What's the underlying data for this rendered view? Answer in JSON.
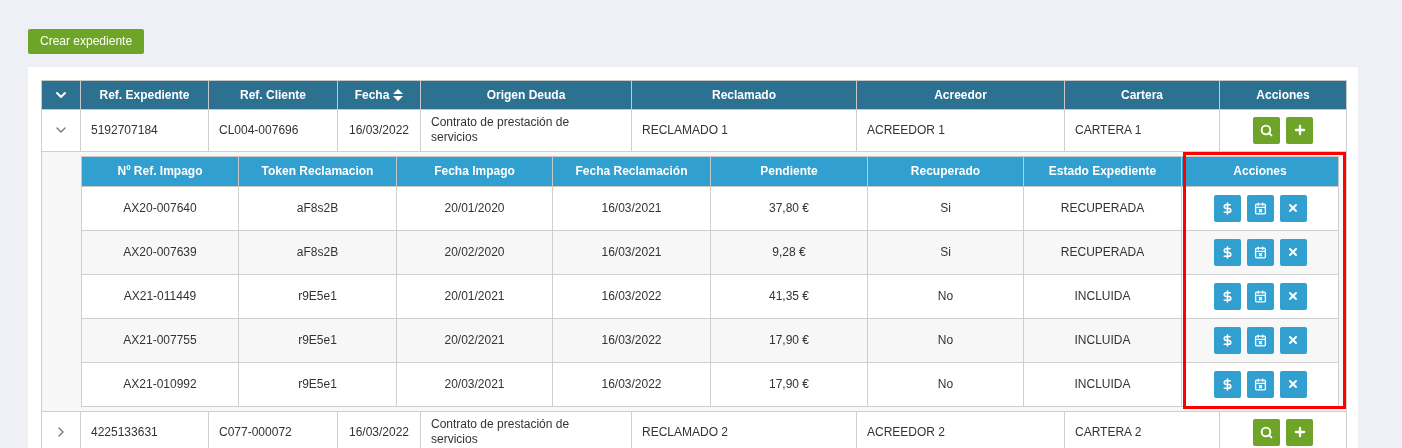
{
  "create_button": "Crear expediente",
  "table": {
    "columns": [
      {
        "label": "Ref. Expediente"
      },
      {
        "label": "Ref. Cliente"
      },
      {
        "label": "Fecha",
        "sortable": true
      },
      {
        "label": "Origen Deuda"
      },
      {
        "label": "Reclamado"
      },
      {
        "label": "Acreedor"
      },
      {
        "label": "Cartera"
      },
      {
        "label": "Acciones"
      }
    ],
    "rows": [
      {
        "expanded": true,
        "cells": [
          "5192707184",
          "CL004-007696",
          "16/03/2022",
          "Contrato de prestación de servicios",
          "RECLAMADO 1",
          "ACREEDOR 1",
          "CARTERA 1"
        ],
        "details": {
          "columns": [
            {
              "label": "Nº Ref. Impago",
              "highlighted": false
            },
            {
              "label": "Token Reclamacion",
              "highlighted": false
            },
            {
              "label": "Fecha Impago",
              "highlighted": false
            },
            {
              "label": "Fecha Reclamación",
              "highlighted": false
            },
            {
              "label": "Pendiente",
              "highlighted": false
            },
            {
              "label": "Recuperado",
              "highlighted": false
            },
            {
              "label": "Estado Expediente",
              "highlighted": false
            },
            {
              "label": "Acciones",
              "highlighted": true
            }
          ],
          "rows": [
            {
              "cells": [
                "AX20-007640",
                "aF8s2B",
                "20/01/2020",
                "16/03/2021",
                "37,80 €",
                "Si",
                "RECUPERADA"
              ]
            },
            {
              "cells": [
                "AX20-007639",
                "aF8s2B",
                "20/02/2020",
                "16/03/2021",
                "9,28 €",
                "Si",
                "RECUPERADA"
              ]
            },
            {
              "cells": [
                "AX21-011449",
                "r9E5e1",
                "20/01/2021",
                "16/03/2022",
                "41,35 €",
                "No",
                "INCLUIDA"
              ]
            },
            {
              "cells": [
                "AX21-007755",
                "r9E5e1",
                "20/02/2021",
                "16/03/2022",
                "17,90 €",
                "No",
                "INCLUIDA"
              ]
            },
            {
              "cells": [
                "AX21-010992",
                "r9E5e1",
                "20/03/2021",
                "16/03/2022",
                "17,90 €",
                "No",
                "INCLUIDA"
              ]
            }
          ]
        }
      },
      {
        "expanded": false,
        "cells": [
          "4225133631",
          "C077-000072",
          "16/03/2022",
          "Contrato de prestación de servicios",
          "RECLAMADO 2",
          "ACREEDOR 2",
          "CARTERA 2"
        ]
      }
    ]
  }
}
